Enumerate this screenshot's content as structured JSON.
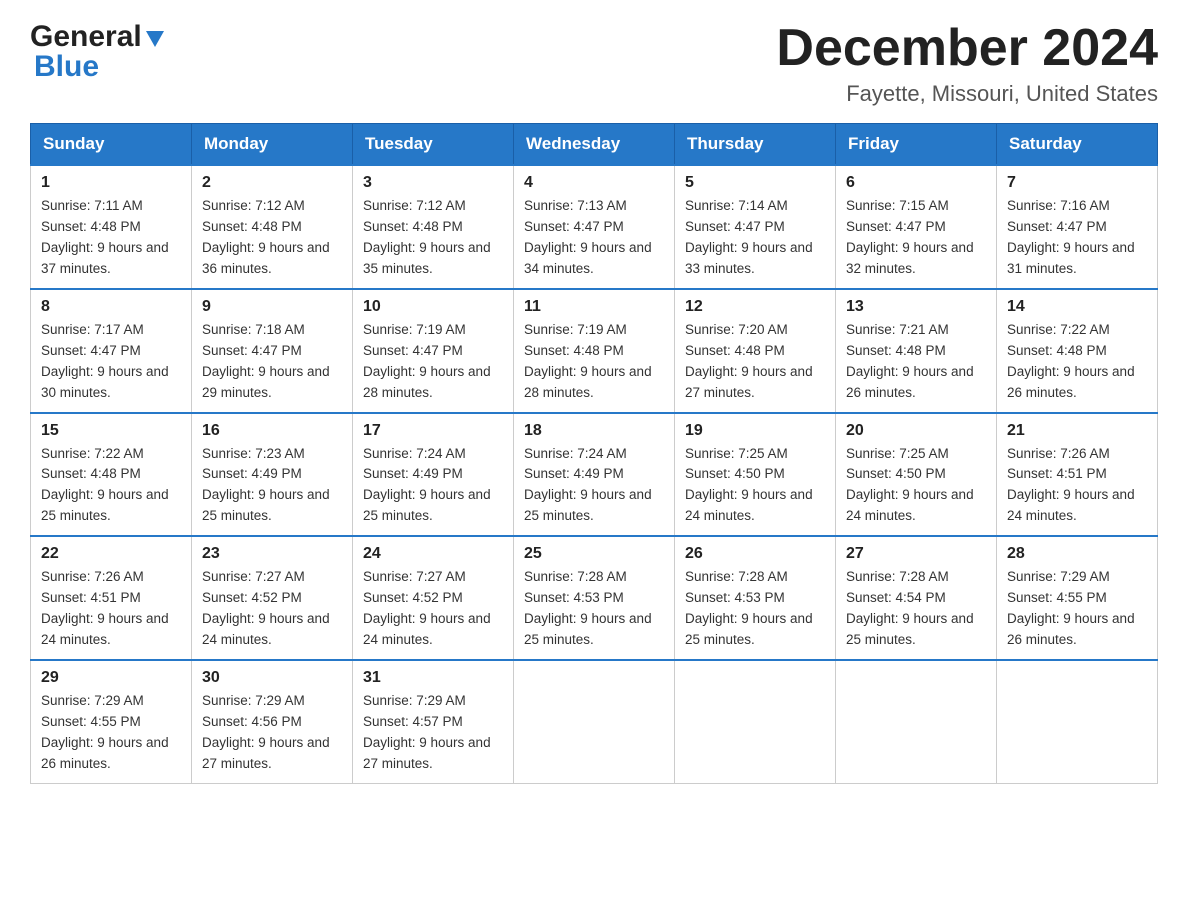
{
  "logo": {
    "general": "General",
    "blue": "Blue"
  },
  "title": {
    "month": "December 2024",
    "location": "Fayette, Missouri, United States"
  },
  "headers": [
    "Sunday",
    "Monday",
    "Tuesday",
    "Wednesday",
    "Thursday",
    "Friday",
    "Saturday"
  ],
  "weeks": [
    [
      {
        "day": "1",
        "sunrise": "Sunrise: 7:11 AM",
        "sunset": "Sunset: 4:48 PM",
        "daylight": "Daylight: 9 hours and 37 minutes."
      },
      {
        "day": "2",
        "sunrise": "Sunrise: 7:12 AM",
        "sunset": "Sunset: 4:48 PM",
        "daylight": "Daylight: 9 hours and 36 minutes."
      },
      {
        "day": "3",
        "sunrise": "Sunrise: 7:12 AM",
        "sunset": "Sunset: 4:48 PM",
        "daylight": "Daylight: 9 hours and 35 minutes."
      },
      {
        "day": "4",
        "sunrise": "Sunrise: 7:13 AM",
        "sunset": "Sunset: 4:47 PM",
        "daylight": "Daylight: 9 hours and 34 minutes."
      },
      {
        "day": "5",
        "sunrise": "Sunrise: 7:14 AM",
        "sunset": "Sunset: 4:47 PM",
        "daylight": "Daylight: 9 hours and 33 minutes."
      },
      {
        "day": "6",
        "sunrise": "Sunrise: 7:15 AM",
        "sunset": "Sunset: 4:47 PM",
        "daylight": "Daylight: 9 hours and 32 minutes."
      },
      {
        "day": "7",
        "sunrise": "Sunrise: 7:16 AM",
        "sunset": "Sunset: 4:47 PM",
        "daylight": "Daylight: 9 hours and 31 minutes."
      }
    ],
    [
      {
        "day": "8",
        "sunrise": "Sunrise: 7:17 AM",
        "sunset": "Sunset: 4:47 PM",
        "daylight": "Daylight: 9 hours and 30 minutes."
      },
      {
        "day": "9",
        "sunrise": "Sunrise: 7:18 AM",
        "sunset": "Sunset: 4:47 PM",
        "daylight": "Daylight: 9 hours and 29 minutes."
      },
      {
        "day": "10",
        "sunrise": "Sunrise: 7:19 AM",
        "sunset": "Sunset: 4:47 PM",
        "daylight": "Daylight: 9 hours and 28 minutes."
      },
      {
        "day": "11",
        "sunrise": "Sunrise: 7:19 AM",
        "sunset": "Sunset: 4:48 PM",
        "daylight": "Daylight: 9 hours and 28 minutes."
      },
      {
        "day": "12",
        "sunrise": "Sunrise: 7:20 AM",
        "sunset": "Sunset: 4:48 PM",
        "daylight": "Daylight: 9 hours and 27 minutes."
      },
      {
        "day": "13",
        "sunrise": "Sunrise: 7:21 AM",
        "sunset": "Sunset: 4:48 PM",
        "daylight": "Daylight: 9 hours and 26 minutes."
      },
      {
        "day": "14",
        "sunrise": "Sunrise: 7:22 AM",
        "sunset": "Sunset: 4:48 PM",
        "daylight": "Daylight: 9 hours and 26 minutes."
      }
    ],
    [
      {
        "day": "15",
        "sunrise": "Sunrise: 7:22 AM",
        "sunset": "Sunset: 4:48 PM",
        "daylight": "Daylight: 9 hours and 25 minutes."
      },
      {
        "day": "16",
        "sunrise": "Sunrise: 7:23 AM",
        "sunset": "Sunset: 4:49 PM",
        "daylight": "Daylight: 9 hours and 25 minutes."
      },
      {
        "day": "17",
        "sunrise": "Sunrise: 7:24 AM",
        "sunset": "Sunset: 4:49 PM",
        "daylight": "Daylight: 9 hours and 25 minutes."
      },
      {
        "day": "18",
        "sunrise": "Sunrise: 7:24 AM",
        "sunset": "Sunset: 4:49 PM",
        "daylight": "Daylight: 9 hours and 25 minutes."
      },
      {
        "day": "19",
        "sunrise": "Sunrise: 7:25 AM",
        "sunset": "Sunset: 4:50 PM",
        "daylight": "Daylight: 9 hours and 24 minutes."
      },
      {
        "day": "20",
        "sunrise": "Sunrise: 7:25 AM",
        "sunset": "Sunset: 4:50 PM",
        "daylight": "Daylight: 9 hours and 24 minutes."
      },
      {
        "day": "21",
        "sunrise": "Sunrise: 7:26 AM",
        "sunset": "Sunset: 4:51 PM",
        "daylight": "Daylight: 9 hours and 24 minutes."
      }
    ],
    [
      {
        "day": "22",
        "sunrise": "Sunrise: 7:26 AM",
        "sunset": "Sunset: 4:51 PM",
        "daylight": "Daylight: 9 hours and 24 minutes."
      },
      {
        "day": "23",
        "sunrise": "Sunrise: 7:27 AM",
        "sunset": "Sunset: 4:52 PM",
        "daylight": "Daylight: 9 hours and 24 minutes."
      },
      {
        "day": "24",
        "sunrise": "Sunrise: 7:27 AM",
        "sunset": "Sunset: 4:52 PM",
        "daylight": "Daylight: 9 hours and 24 minutes."
      },
      {
        "day": "25",
        "sunrise": "Sunrise: 7:28 AM",
        "sunset": "Sunset: 4:53 PM",
        "daylight": "Daylight: 9 hours and 25 minutes."
      },
      {
        "day": "26",
        "sunrise": "Sunrise: 7:28 AM",
        "sunset": "Sunset: 4:53 PM",
        "daylight": "Daylight: 9 hours and 25 minutes."
      },
      {
        "day": "27",
        "sunrise": "Sunrise: 7:28 AM",
        "sunset": "Sunset: 4:54 PM",
        "daylight": "Daylight: 9 hours and 25 minutes."
      },
      {
        "day": "28",
        "sunrise": "Sunrise: 7:29 AM",
        "sunset": "Sunset: 4:55 PM",
        "daylight": "Daylight: 9 hours and 26 minutes."
      }
    ],
    [
      {
        "day": "29",
        "sunrise": "Sunrise: 7:29 AM",
        "sunset": "Sunset: 4:55 PM",
        "daylight": "Daylight: 9 hours and 26 minutes."
      },
      {
        "day": "30",
        "sunrise": "Sunrise: 7:29 AM",
        "sunset": "Sunset: 4:56 PM",
        "daylight": "Daylight: 9 hours and 27 minutes."
      },
      {
        "day": "31",
        "sunrise": "Sunrise: 7:29 AM",
        "sunset": "Sunset: 4:57 PM",
        "daylight": "Daylight: 9 hours and 27 minutes."
      },
      null,
      null,
      null,
      null
    ]
  ]
}
